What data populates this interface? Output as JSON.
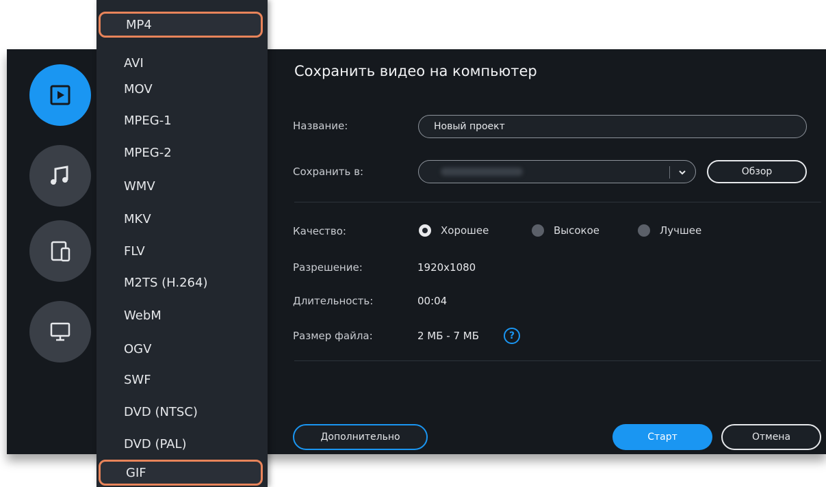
{
  "dialog": {
    "title": "Сохранить видео на компьютер"
  },
  "categories": [
    {
      "name": "video",
      "icon": "play-icon",
      "active": true
    },
    {
      "name": "audio",
      "icon": "music-note-icon",
      "active": false
    },
    {
      "name": "devices",
      "icon": "devices-icon",
      "active": false
    },
    {
      "name": "tv",
      "icon": "monitor-icon",
      "active": false
    }
  ],
  "formats": [
    "MP4",
    "AVI",
    "MOV",
    "MPEG-1",
    "MPEG-2",
    "WMV",
    "MKV",
    "FLV",
    "M2TS (H.264)",
    "WebM",
    "OGV",
    "SWF",
    "DVD (NTSC)",
    "DVD (PAL)",
    "GIF"
  ],
  "highlighted_formats": [
    "MP4",
    "GIF"
  ],
  "form": {
    "name_label": "Название:",
    "name_value": "Новый проект",
    "save_to_label": "Сохранить в:",
    "browse_label": "Обзор",
    "quality_label": "Качество:",
    "quality_options": [
      "Хорошее",
      "Высокое",
      "Лучшее"
    ],
    "quality_selected": "Хорошее",
    "resolution_label": "Разрешение:",
    "resolution_value": "1920x1080",
    "duration_label": "Длительность:",
    "duration_value": "00:04",
    "filesize_label": "Размер файла:",
    "filesize_value": "2 МБ - 7 МБ",
    "help_symbol": "?"
  },
  "footer": {
    "advanced_label": "Дополнительно",
    "start_label": "Старт",
    "cancel_label": "Отмена"
  },
  "colors": {
    "accent": "#1a96f2",
    "highlight": "#e8845a",
    "background": "#15191e",
    "list_background": "#22272e"
  }
}
